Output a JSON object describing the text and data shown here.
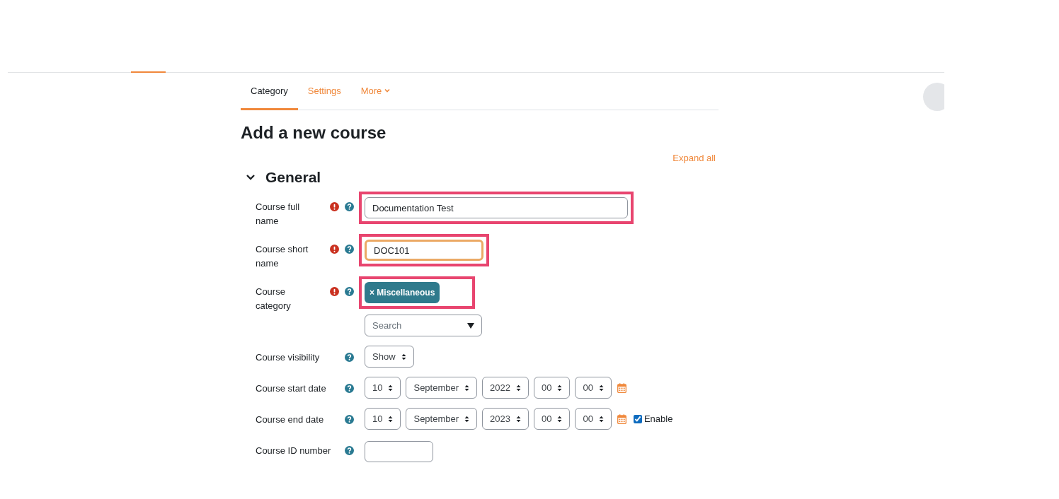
{
  "tabs": [
    {
      "label": "Category",
      "selected": true,
      "kind": "link"
    },
    {
      "label": "Settings",
      "selected": false,
      "kind": "link"
    },
    {
      "label": "More",
      "selected": false,
      "kind": "menu"
    }
  ],
  "heading": "Add a new course",
  "expand_all": "Expand all",
  "section": {
    "title": "General",
    "expanded": true
  },
  "fields": [
    {
      "kind": "text",
      "label": "Course full name",
      "required": true,
      "value": "Documentation Test",
      "highlighted": true,
      "focused": false
    },
    {
      "kind": "text",
      "label": "Course short name",
      "required": true,
      "value": "DOC101",
      "highlighted": true,
      "focused": true
    },
    {
      "kind": "autocomplete",
      "label": "Course category",
      "required": true,
      "tags": [
        "× Miscellaneous"
      ],
      "placeholder": "Search",
      "highlighted": true
    },
    {
      "kind": "select",
      "label": "Course visibility",
      "required": false,
      "selects": [
        "Show"
      ]
    },
    {
      "kind": "date",
      "label": "Course start date",
      "required": false,
      "selects": [
        "10",
        "September",
        "2022",
        "00",
        "00"
      ]
    },
    {
      "kind": "date",
      "label": "Course end date",
      "required": false,
      "selects": [
        "10",
        "September",
        "2023",
        "00",
        "00"
      ],
      "enable": {
        "label": "Enable",
        "checked": true
      }
    },
    {
      "kind": "text",
      "label": "Course ID number",
      "required": false,
      "highlighted": false,
      "focused": false
    }
  ]
}
